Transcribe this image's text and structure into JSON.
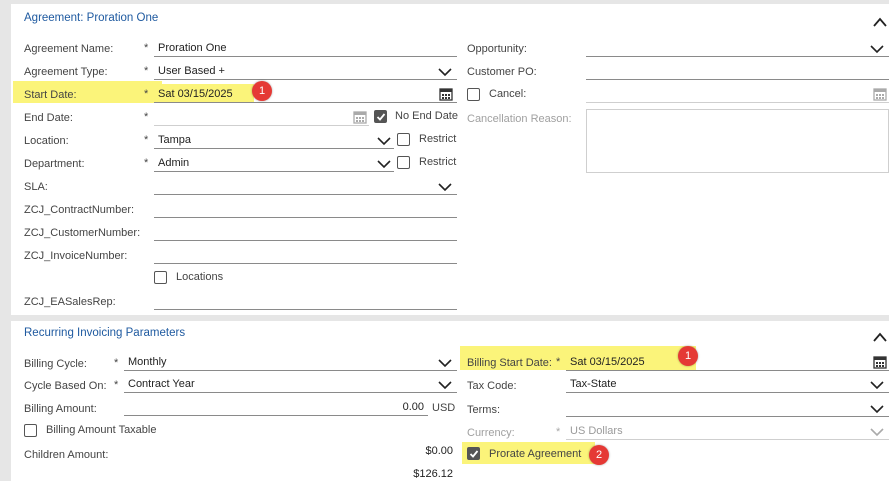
{
  "agreement": {
    "title": "Agreement: Proration One",
    "fields": {
      "agreement_name": {
        "label": "Agreement Name:",
        "value": "Proration One"
      },
      "agreement_type": {
        "label": "Agreement Type:",
        "value": "User Based +"
      },
      "start_date": {
        "label": "Start Date:",
        "value": "Sat 03/15/2025"
      },
      "end_date": {
        "label": "End Date:",
        "value": ""
      },
      "no_end_date": {
        "label": "No End Date",
        "checked": true
      },
      "location": {
        "label": "Location:",
        "value": "Tampa"
      },
      "location_restrict": {
        "label": "Restrict",
        "checked": false
      },
      "department": {
        "label": "Department:",
        "value": "Admin"
      },
      "department_restrict": {
        "label": "Restrict",
        "checked": false
      },
      "sla": {
        "label": "SLA:",
        "value": ""
      },
      "contract_number": {
        "label": "ZCJ_ContractNumber:",
        "value": ""
      },
      "customer_number": {
        "label": "ZCJ_CustomerNumber:",
        "value": ""
      },
      "invoice_number": {
        "label": "ZCJ_InvoiceNumber:",
        "value": ""
      },
      "locations": {
        "label": "Locations",
        "checked": false
      },
      "ea_sales_rep": {
        "label": "ZCJ_EASalesRep:",
        "value": ""
      },
      "opportunity": {
        "label": "Opportunity:",
        "value": ""
      },
      "customer_po": {
        "label": "Customer PO:",
        "value": ""
      },
      "cancel": {
        "label": "Cancel:",
        "checked": false
      },
      "cancellation_reason": {
        "label": "Cancellation Reason:",
        "value": ""
      }
    }
  },
  "recurring": {
    "title": "Recurring Invoicing Parameters",
    "fields": {
      "billing_cycle": {
        "label": "Billing Cycle:",
        "value": "Monthly"
      },
      "cycle_based_on": {
        "label": "Cycle Based On:",
        "value": "Contract Year"
      },
      "billing_amount": {
        "label": "Billing Amount:",
        "value": "0.00",
        "currency": "USD"
      },
      "billing_amount_taxable": {
        "label": "Billing Amount Taxable",
        "checked": false
      },
      "children_amount": {
        "label": "Children Amount:",
        "value": "$0.00"
      },
      "children_amount_next": {
        "value": "$126.12"
      },
      "billing_start_date": {
        "label": "Billing Start Date:",
        "value": "Sat 03/15/2025"
      },
      "tax_code": {
        "label": "Tax Code:",
        "value": "Tax-State"
      },
      "terms": {
        "label": "Terms:",
        "value": ""
      },
      "currency": {
        "label": "Currency:",
        "value": "US Dollars"
      },
      "prorate_agreement": {
        "label": "Prorate Agreement",
        "checked": true
      }
    }
  },
  "markers": {
    "one": "1",
    "one_b": "1",
    "two": "2"
  },
  "required_mark": "*",
  "colors": {
    "title": "#1f5aa0",
    "highlight": "#fbf47a",
    "badge": "#e53935"
  }
}
